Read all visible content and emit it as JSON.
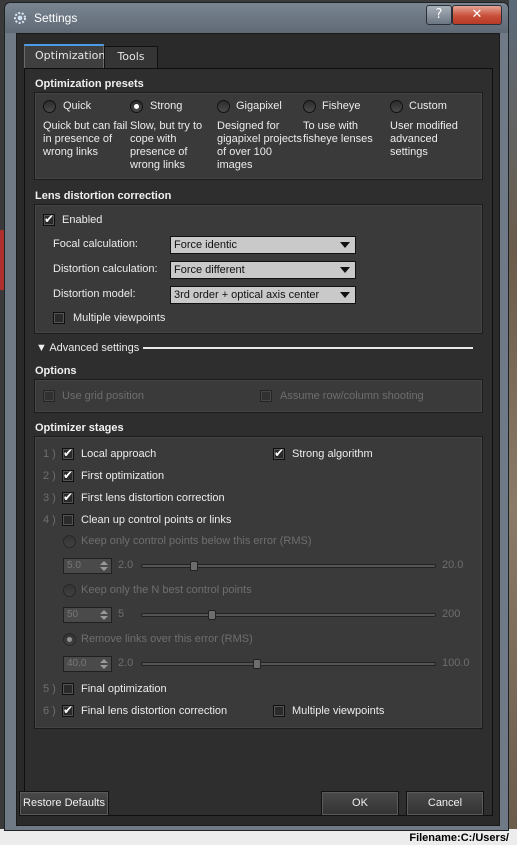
{
  "window": {
    "title": "Settings",
    "help_label": "?",
    "close_label": "✕"
  },
  "tabs": [
    {
      "label": "Optimization"
    },
    {
      "label": "Tools"
    }
  ],
  "presets": {
    "title": "Optimization presets",
    "items": [
      {
        "label": "Quick",
        "desc": "Quick but can fail in presence of wrong links",
        "selected": false
      },
      {
        "label": "Strong",
        "desc": "Slow, but try to cope with presence of wrong links",
        "selected": true
      },
      {
        "label": "Gigapixel",
        "desc": "Designed for gigapixel projects of over 100 images",
        "selected": false
      },
      {
        "label": "Fisheye",
        "desc": "To use with fisheye lenses",
        "selected": false
      },
      {
        "label": "Custom",
        "desc": "User modified advanced settings",
        "selected": false
      }
    ]
  },
  "lens": {
    "title": "Lens distortion correction",
    "enabled_label": "Enabled",
    "focal_label": "Focal calculation:",
    "focal_value": "Force identic",
    "distortion_label": "Distortion calculation:",
    "distortion_value": "Force different",
    "model_label": "Distortion model:",
    "model_value": "3rd order + optical axis center",
    "multi_label": "Multiple viewpoints"
  },
  "advanced": {
    "label": "Advanced settings"
  },
  "options": {
    "title": "Options",
    "grid_label": "Use grid position",
    "rowcol_label": "Assume row/column shooting"
  },
  "stages": {
    "title": "Optimizer stages",
    "s1": {
      "num": "1 )",
      "label": "Local approach",
      "extra_label": "Strong algorithm"
    },
    "s2": {
      "num": "2 )",
      "label": "First optimization"
    },
    "s3": {
      "num": "3 )",
      "label": "First lens distortion correction"
    },
    "s4": {
      "num": "4 )",
      "label": "Clean up control points or links"
    },
    "keep_below": {
      "label": "Keep only control points below this error (RMS)",
      "value": "5.0",
      "min": "2.0",
      "max": "20.0",
      "level": 0.17
    },
    "keep_best": {
      "label": "Keep only the N best control points",
      "value": "50",
      "min": "5",
      "max": "200",
      "level": 0.23
    },
    "remove_links": {
      "label": "Remove links over this error (RMS)",
      "value": "40.0",
      "min": "2.0",
      "max": "100.0",
      "level": 0.39
    },
    "s5": {
      "num": "5 )",
      "label": "Final optimization"
    },
    "s6": {
      "num": "6 )",
      "label": "Final lens distortion correction",
      "extra_label": "Multiple viewpoints"
    }
  },
  "buttons": {
    "restore": "Restore Defaults",
    "ok": "OK",
    "cancel": "Cancel"
  },
  "background": {
    "filename": "Filename:C:/Users/"
  }
}
